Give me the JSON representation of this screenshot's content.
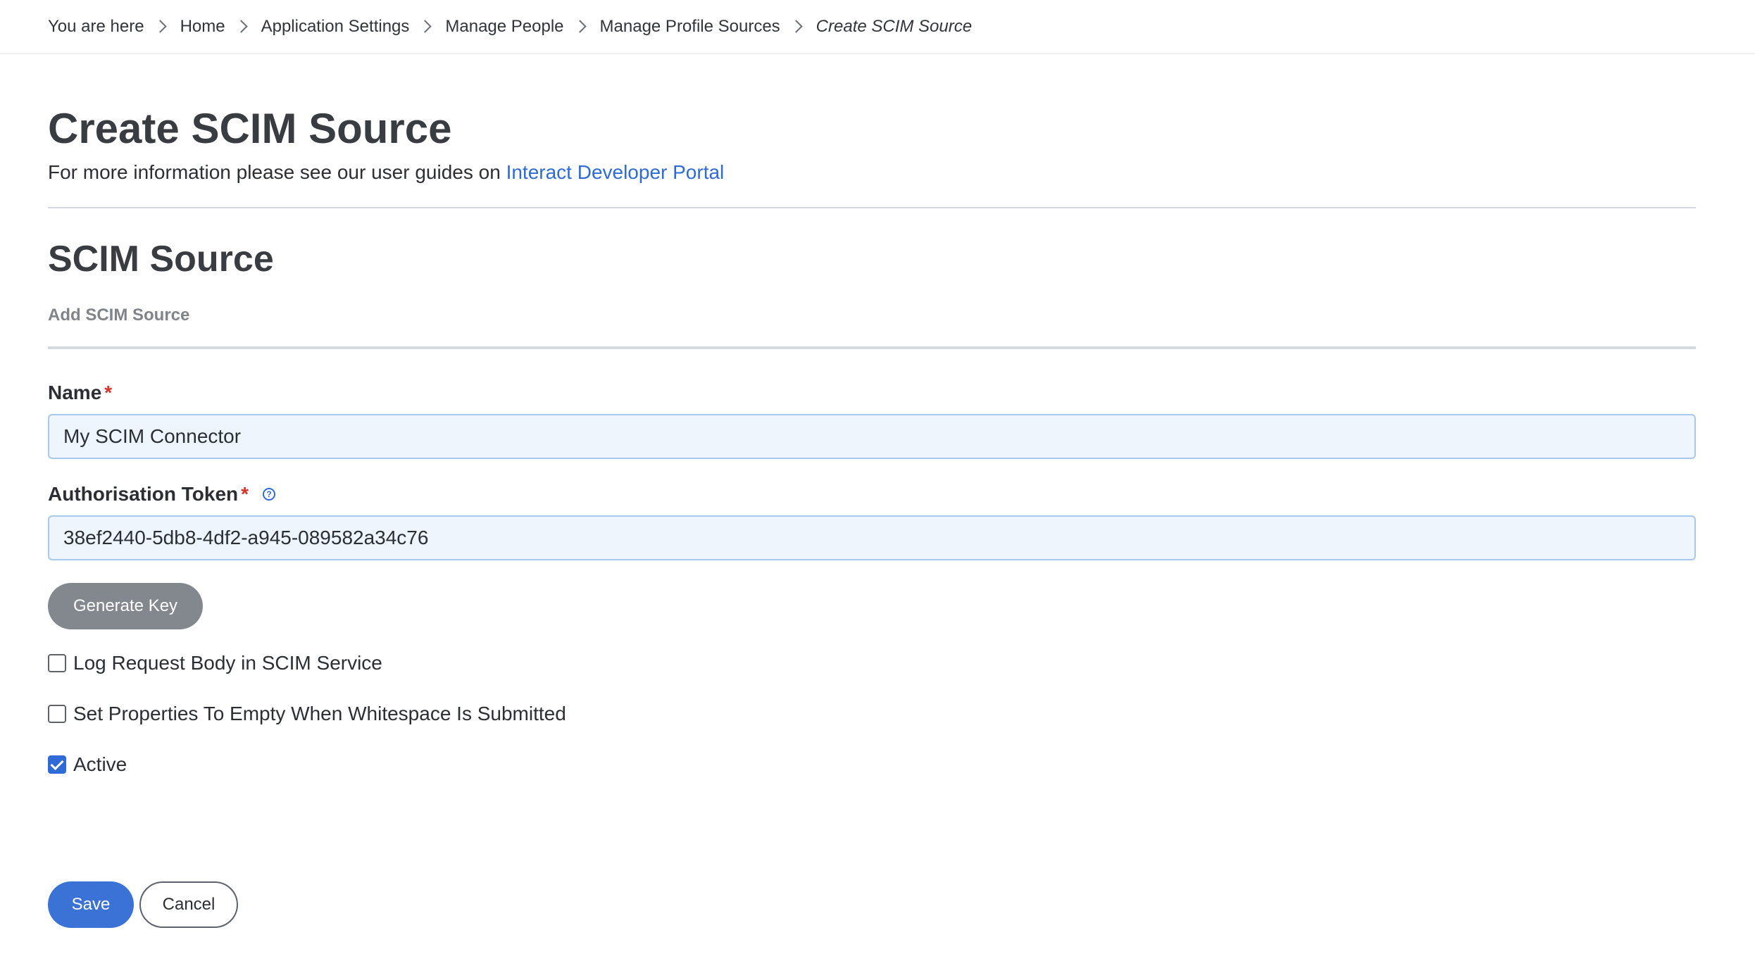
{
  "breadcrumb": {
    "lead": "You are here",
    "items": [
      "Home",
      "Application Settings",
      "Manage People",
      "Manage Profile Sources"
    ],
    "current": "Create SCIM Source"
  },
  "page": {
    "title": "Create SCIM Source",
    "subtitle_prefix": "For more information please see our user guides on ",
    "subtitle_link": "Interact Developer Portal"
  },
  "section": {
    "title": "SCIM Source",
    "subtitle": "Add SCIM Source"
  },
  "form": {
    "name_label": "Name",
    "name_value": "My SCIM Connector",
    "token_label": "Authorisation Token",
    "token_value": "38ef2440-5db8-4df2-a945-089582a34c76",
    "required_marker": "*",
    "help_icon": "?",
    "generate_label": "Generate Key",
    "checkboxes": [
      {
        "label": "Log Request Body in SCIM Service",
        "checked": false
      },
      {
        "label": "Set Properties To Empty When Whitespace Is Submitted",
        "checked": false
      },
      {
        "label": "Active",
        "checked": true
      }
    ]
  },
  "actions": {
    "save_label": "Save",
    "cancel_label": "Cancel"
  },
  "colors": {
    "link": "#2f6bd6",
    "primary_button": "#3b72d6",
    "secondary_button": "#83888e",
    "required": "#d6342a"
  }
}
